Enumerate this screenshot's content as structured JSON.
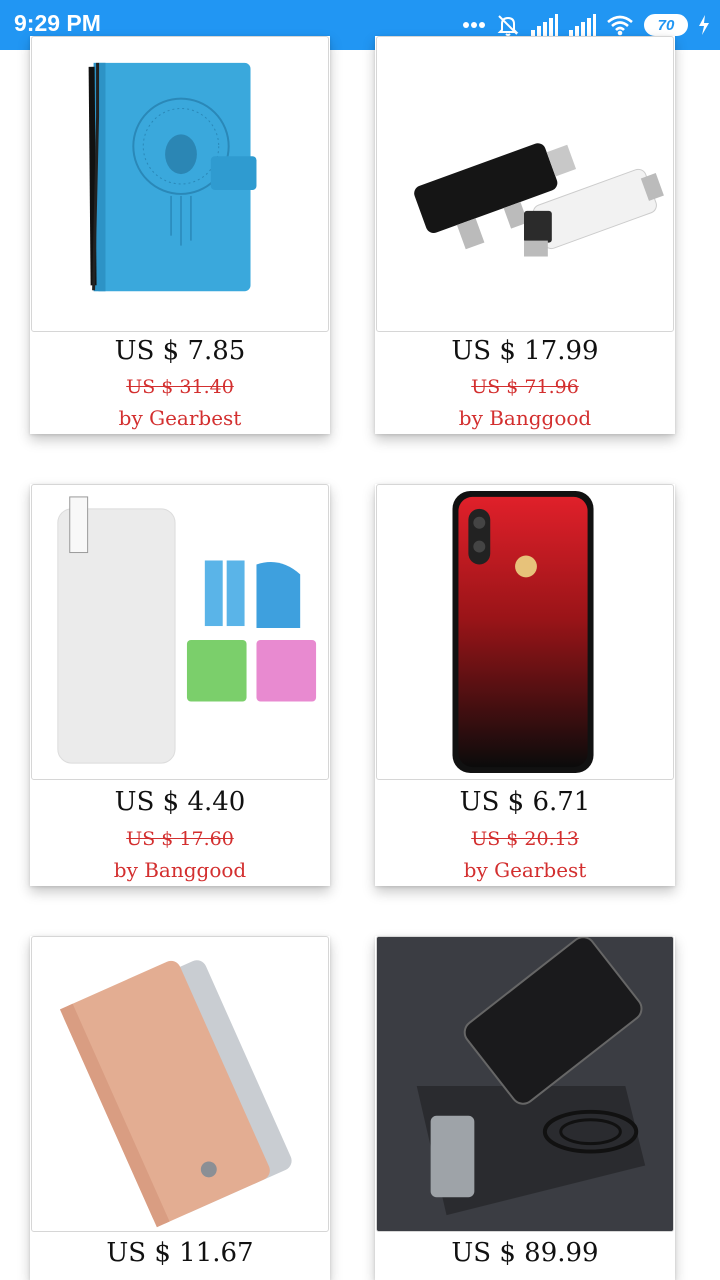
{
  "status_bar": {
    "time": "9:29 PM",
    "battery": "70",
    "icons": [
      "more-dots-icon",
      "alarm-off-icon",
      "signal-icon",
      "signal-icon",
      "wifi-icon",
      "battery-icon",
      "charging-icon"
    ]
  },
  "colors": {
    "status_bar": "#2196f3",
    "sale_text": "#d32f2f"
  },
  "products": [
    {
      "price": "US $ 7.85",
      "old_price": "US $ 31.40",
      "seller": "by Gearbest",
      "image": "blue-wallet-phone-case"
    },
    {
      "price": "US $ 17.99",
      "old_price": "US $ 71.96",
      "seller": "by Banggood",
      "image": "4-in-1-card-reader"
    },
    {
      "price": "US $ 4.40",
      "old_price": "US $ 17.60",
      "seller": "by Banggood",
      "image": "screen-protector-kit"
    },
    {
      "price": "US $ 6.71",
      "old_price": "US $ 20.13",
      "seller": "by Gearbest",
      "image": "red-gradient-phone-case"
    },
    {
      "price": "US $ 11.67",
      "image": "rose-gold-flip-case"
    },
    {
      "price": "US $ 89.99",
      "image": "wireless-charging-dock"
    }
  ]
}
